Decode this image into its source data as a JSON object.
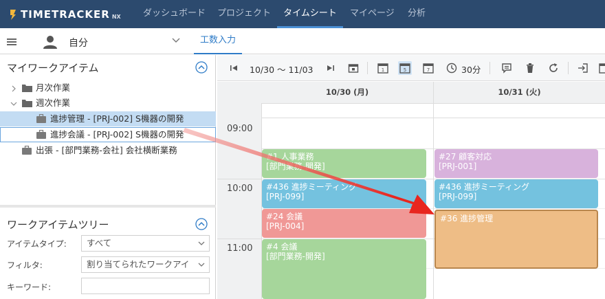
{
  "app": {
    "logo_text": "TIMETRACKER",
    "logo_suffix": "NX",
    "nav": [
      "ダッシュボード",
      "プロジェクト",
      "タイムシート",
      "マイページ",
      "分析"
    ]
  },
  "subbar": {
    "user_label": "自分",
    "tab_label": "工数入力"
  },
  "my_work_items": {
    "title": "マイワークアイテム",
    "tree": [
      {
        "label": "月次作業",
        "kind": "folder",
        "expanded": false
      },
      {
        "label": "週次作業",
        "kind": "folder",
        "expanded": true
      },
      {
        "label": "進捗管理 - [PRJ-002] S機器の開発",
        "kind": "item",
        "state": "selected"
      },
      {
        "label": "進捗会議 - [PRJ-002] S機器の開発",
        "kind": "item",
        "state": "outlined"
      },
      {
        "label": "出張 - [部門業務-会社] 会社横断業務",
        "kind": "item",
        "state": "normal"
      }
    ]
  },
  "work_item_tree": {
    "title": "ワークアイテムツリー",
    "fields": [
      {
        "label": "アイテムタイプ:",
        "value": "すべて",
        "dropdown": true
      },
      {
        "label": "フィルタ:",
        "value": "割り当てられたワークアイ",
        "dropdown": true
      },
      {
        "label": "キーワード:",
        "value": "",
        "dropdown": false
      }
    ]
  },
  "toolbar": {
    "date_range": "10/30 ～ 11/03",
    "interval": "30分",
    "calendar_day_1": "1",
    "calendar_day_5": "5",
    "calendar_day_7": "7"
  },
  "calendar": {
    "days": [
      "10/30 (月)",
      "10/31 (火)"
    ],
    "times": [
      "09:00",
      "10:00",
      "11:00"
    ],
    "events": [
      {
        "day": 0,
        "line1": "#1 人事業務",
        "line2": "[部門業務-開発]",
        "color": "#a6d69b",
        "start": "09:30",
        "end": "10:00"
      },
      {
        "day": 0,
        "line1": "#436 進捗ミーティング",
        "line2": "[PRJ-099]",
        "color": "#74c2df",
        "start": "10:00",
        "end": "10:30"
      },
      {
        "day": 0,
        "line1": "#24 会議",
        "line2": "[PRJ-004]",
        "color": "#f09896",
        "start": "10:30",
        "end": "11:00"
      },
      {
        "day": 0,
        "line1": "#4 会議",
        "line2": "[部門業務-開発]",
        "color": "#a6d69b",
        "start": "11:00",
        "end": "12:00"
      },
      {
        "day": 1,
        "line1": "#27 顧客対応",
        "line2": "[PRJ-001]",
        "color": "#d8b2dc",
        "start": "09:30",
        "end": "10:00"
      },
      {
        "day": 1,
        "line1": "#436 進捗ミーティング",
        "line2": "[PRJ-099]",
        "color": "#74c2df",
        "start": "10:00",
        "end": "10:30"
      },
      {
        "day": 1,
        "line1": "#36 進捗管理",
        "line2": "",
        "color": "#eebd86",
        "start": "10:30",
        "end": "11:30"
      }
    ]
  },
  "colors": {
    "nav_bg": "#2c4a6e",
    "accent": "#2e7bc7",
    "drag_arrow": "#e8261f"
  }
}
